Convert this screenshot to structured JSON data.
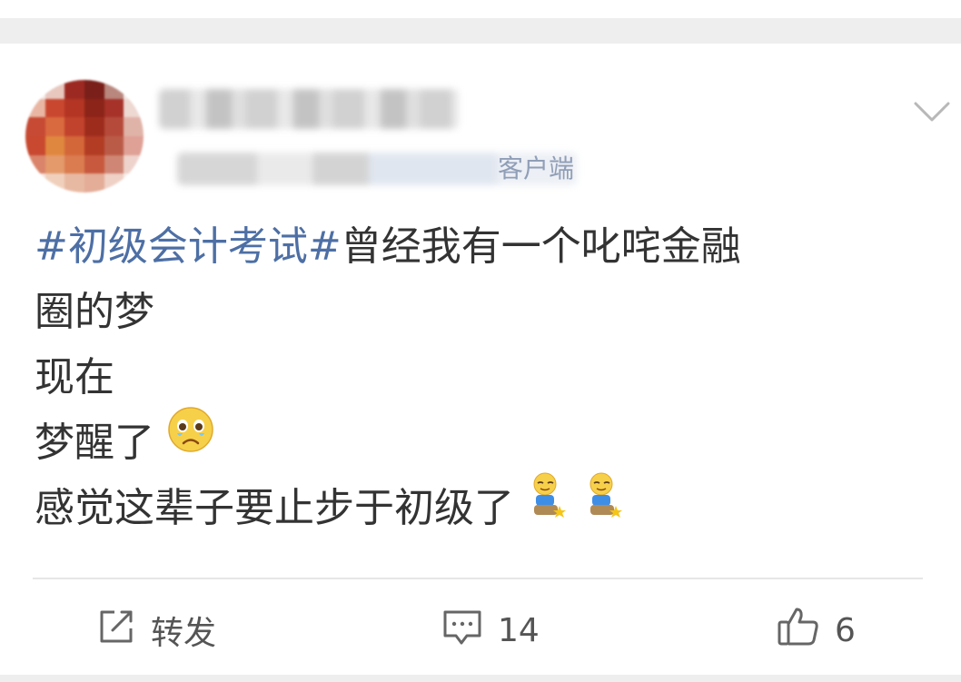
{
  "header": {
    "username": "",
    "meta_visible": "客户端"
  },
  "post": {
    "lines": [
      {
        "hashtag": "#初级会计考试#",
        "text": "曾经我有一个叱咤金融"
      },
      {
        "text": "圈的梦"
      },
      {
        "text": "现在"
      },
      {
        "text": "梦醒了"
      },
      {
        "text": "感觉这辈子要止步于初级了"
      }
    ],
    "emojis": [
      "crying-face-emoji",
      "sitting-figure-emoji"
    ]
  },
  "actions": {
    "repost": {
      "icon": "share-icon",
      "label": "转发"
    },
    "comment": {
      "icon": "comment-icon",
      "count": "14"
    },
    "like": {
      "icon": "thumbs-up-icon",
      "count": "6"
    }
  },
  "colors": {
    "hashtag": "#4d6fa5",
    "text": "#333333",
    "icon": "#666666",
    "background": "#ffffff",
    "separator": "#eeeeee"
  }
}
